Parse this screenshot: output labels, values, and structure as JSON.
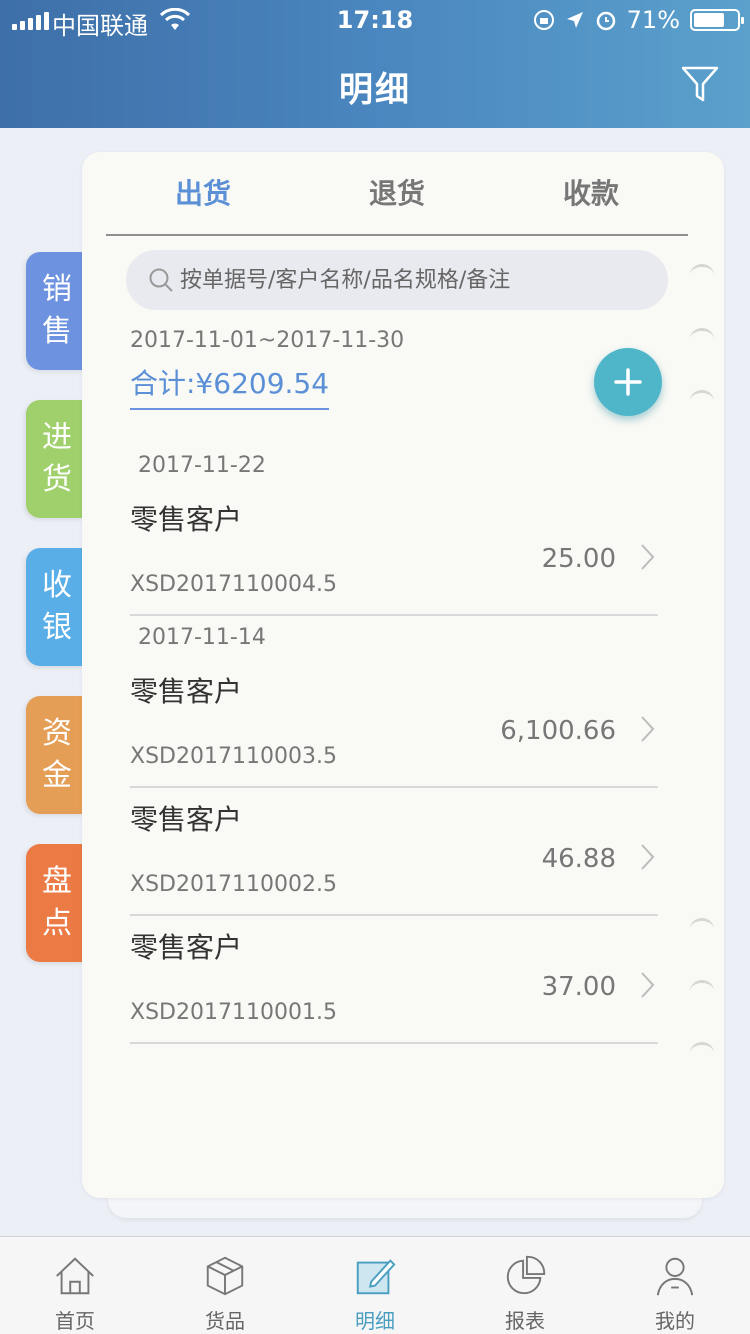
{
  "status_bar": {
    "carrier": "中国联通",
    "time": "17:18",
    "battery": "71%"
  },
  "header": {
    "title": "明细"
  },
  "side_tabs": [
    {
      "label_lines": [
        "销",
        "售"
      ],
      "color": "#6d93e0",
      "active": true
    },
    {
      "label_lines": [
        "进",
        "货"
      ],
      "color": "#9fd06c",
      "active": false
    },
    {
      "label_lines": [
        "收",
        "银"
      ],
      "color": "#5aaee8",
      "active": false
    },
    {
      "label_lines": [
        "资",
        "金"
      ],
      "color": "#e59e56",
      "active": false
    },
    {
      "label_lines": [
        "盘",
        "点"
      ],
      "color": "#ec7a44",
      "active": false
    }
  ],
  "tabs": [
    {
      "label": "出货",
      "active": true
    },
    {
      "label": "退货",
      "active": false
    },
    {
      "label": "收款",
      "active": false
    }
  ],
  "search": {
    "placeholder": "按单据号/客户名称/品名规格/备注"
  },
  "summary": {
    "date_range": "2017-11-01~2017-11-30",
    "total": "合计:¥6209.54"
  },
  "groups": [
    {
      "date": "2017-11-22",
      "rows": [
        {
          "customer": "零售客户",
          "amount": "25.00",
          "order": "XSD2017110004.5"
        }
      ]
    },
    {
      "date": "2017-11-14",
      "rows": [
        {
          "customer": "零售客户",
          "amount": "6,100.66",
          "order": "XSD2017110003.5"
        },
        {
          "customer": "零售客户",
          "amount": "46.88",
          "order": "XSD2017110002.5"
        },
        {
          "customer": "零售客户",
          "amount": "37.00",
          "order": "XSD2017110001.5"
        }
      ]
    }
  ],
  "bottom_nav": [
    {
      "label": "首页",
      "icon": "home-icon",
      "active": false
    },
    {
      "label": "货品",
      "icon": "box-icon",
      "active": false
    },
    {
      "label": "明细",
      "icon": "edit-icon",
      "active": true
    },
    {
      "label": "报表",
      "icon": "pie-chart-icon",
      "active": false
    },
    {
      "label": "我的",
      "icon": "user-icon",
      "active": false
    }
  ],
  "colors": {
    "accent": "#5b8fd6",
    "add_button": "#4fb6c9",
    "nav_active": "#4a9ec0"
  }
}
